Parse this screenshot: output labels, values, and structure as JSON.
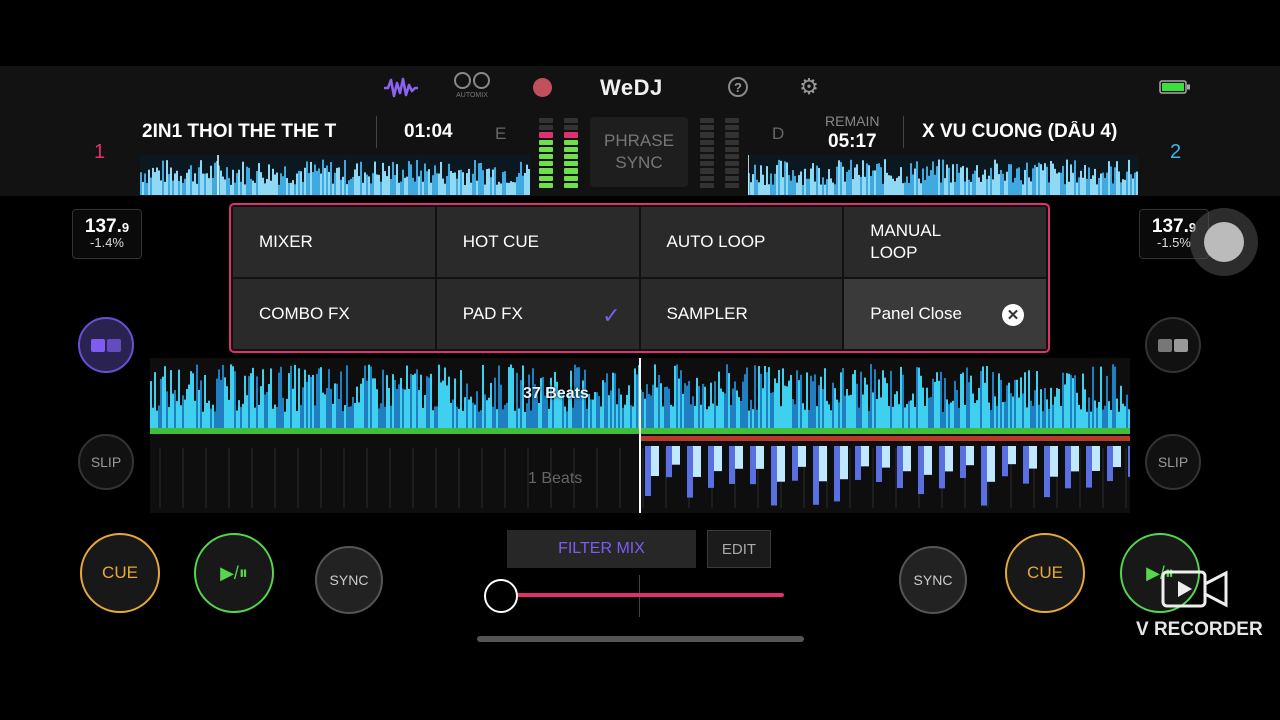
{
  "app": {
    "logo": "WeDJ"
  },
  "toolbar": {
    "automix_label": "AUTOMIX"
  },
  "deck1": {
    "number": "1",
    "title": "2IN1 THOI THE THE T",
    "time": "01:04",
    "key": "E",
    "bpm_int": "137.",
    "bpm_dec": "9",
    "pitch": "-1.4%",
    "cue_label": "CUE",
    "play_label": "▶/⏸",
    "sync_label": "SYNC",
    "slip_label": "SLIP"
  },
  "deck2": {
    "number": "2",
    "title": "X VU CUONG (DẤU 4)",
    "remain_label": "REMAIN",
    "time": "05:17",
    "key": "D",
    "bpm_int": "137.",
    "bpm_dec": "9",
    "pitch": "-1.5%",
    "cue_label": "CUE",
    "play_label": "▶/⏸",
    "sync_label": "SYNC",
    "slip_label": "SLIP"
  },
  "phrase_sync": {
    "line1": "PHRASE",
    "line2": "SYNC"
  },
  "panel": {
    "items": [
      {
        "label": "MIXER"
      },
      {
        "label": "HOT CUE"
      },
      {
        "label": "AUTO LOOP"
      },
      {
        "label": "MANUAL LOOP"
      },
      {
        "label": "COMBO FX"
      },
      {
        "label": "PAD FX",
        "checked": true
      },
      {
        "label": "SAMPLER"
      },
      {
        "label": "Panel Close"
      }
    ]
  },
  "waveform": {
    "upper_beats": "37 Beats",
    "lower_beats": "1 Beats"
  },
  "mixer": {
    "filter_mix_label": "FILTER MIX",
    "edit_label": "EDIT",
    "crossfader_position": 0.0
  },
  "watermark": {
    "text": "V RECORDER"
  },
  "colors": {
    "deck1_accent": "#e0306f",
    "deck2_accent": "#3fb6e8",
    "cue": "#e7a93a",
    "play": "#55d64d",
    "active_purple": "#7d5cf0",
    "panel_border": "#e0306f"
  }
}
